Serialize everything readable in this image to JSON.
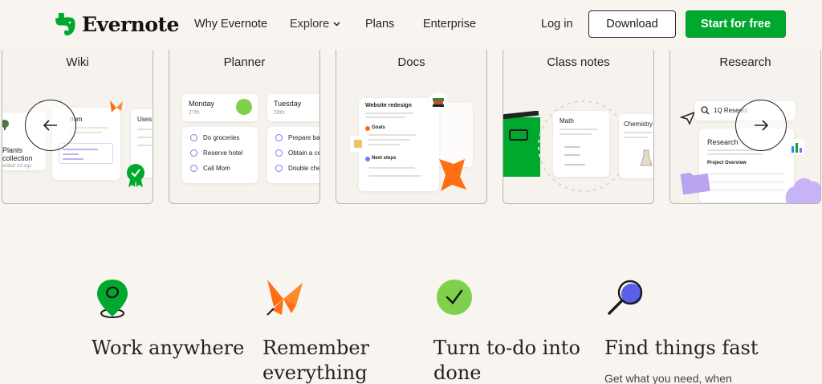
{
  "brand": {
    "name": "Evernote",
    "green": "#00a82d"
  },
  "nav": {
    "why": "Why Evernote",
    "explore": "Explore",
    "plans": "Plans",
    "enterprise": "Enterprise",
    "login": "Log in",
    "download": "Download",
    "start": "Start for free"
  },
  "carousel": {
    "cards": [
      {
        "title": "Wiki",
        "doc_title": "rium",
        "plants": "Plants collection",
        "edited": "edited 2d ago",
        "side_label": "Uses"
      },
      {
        "title": "Planner",
        "day1": "Monday",
        "day1_date": "27th",
        "day2": "Tuesday",
        "day2_date": "28th",
        "tasks1": [
          "Do groceries",
          "Reserve hotel",
          "Call Mom"
        ],
        "tasks2": [
          "Prepare bac",
          "Obtain a ce",
          "Double che"
        ]
      },
      {
        "title": "Docs",
        "doc_title": "Website redesign",
        "goals": "Goals",
        "next_steps": "Next steps"
      },
      {
        "title": "Class notes",
        "subject1": "Math",
        "subject2": "Chemistry"
      },
      {
        "title": "Research",
        "search": "1Q Researc",
        "doc_title": "Research",
        "overview": "Project Overview"
      }
    ],
    "prev_icon": "arrow-left-icon",
    "next_icon": "arrow-right-icon"
  },
  "features": [
    {
      "title": "Work anywhere",
      "icon": "map-pin-icon",
      "desc": ""
    },
    {
      "title": "Remember everything",
      "icon": "butterfly-icon",
      "desc": ""
    },
    {
      "title": "Turn to-do into done",
      "icon": "check-circle-icon",
      "desc": ""
    },
    {
      "title": "Find things fast",
      "icon": "magnifier-icon",
      "desc": "Get what you need, when"
    }
  ]
}
